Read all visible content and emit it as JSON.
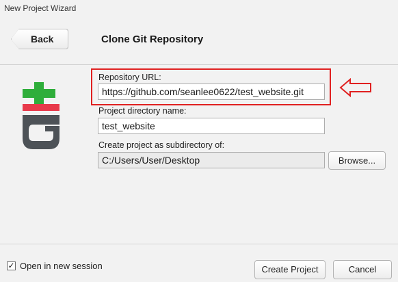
{
  "window": {
    "title": "New Project Wizard"
  },
  "header": {
    "back_label": "Back",
    "title": "Clone Git Repository"
  },
  "form": {
    "repo_url_label": "Repository URL:",
    "repo_url_value": "https://github.com/seanlee0622/test_website.git",
    "dir_name_label": "Project directory name:",
    "dir_name_value": "test_website",
    "subdir_label": "Create project as subdirectory of:",
    "subdir_value": "C:/Users/User/Desktop",
    "browse_label": "Browse..."
  },
  "footer": {
    "open_new_session_label": "Open in new session",
    "open_new_session_checked": true,
    "checkmark": "✓",
    "create_label": "Create Project",
    "cancel_label": "Cancel"
  },
  "colors": {
    "git_green": "#2fae3b",
    "git_red": "#e8394a",
    "git_gray": "#4d5257",
    "highlight": "#e02020"
  },
  "icons": [
    "git-logo",
    "back-arrow-icon",
    "annotation-arrow-icon",
    "checkmark-icon"
  ]
}
